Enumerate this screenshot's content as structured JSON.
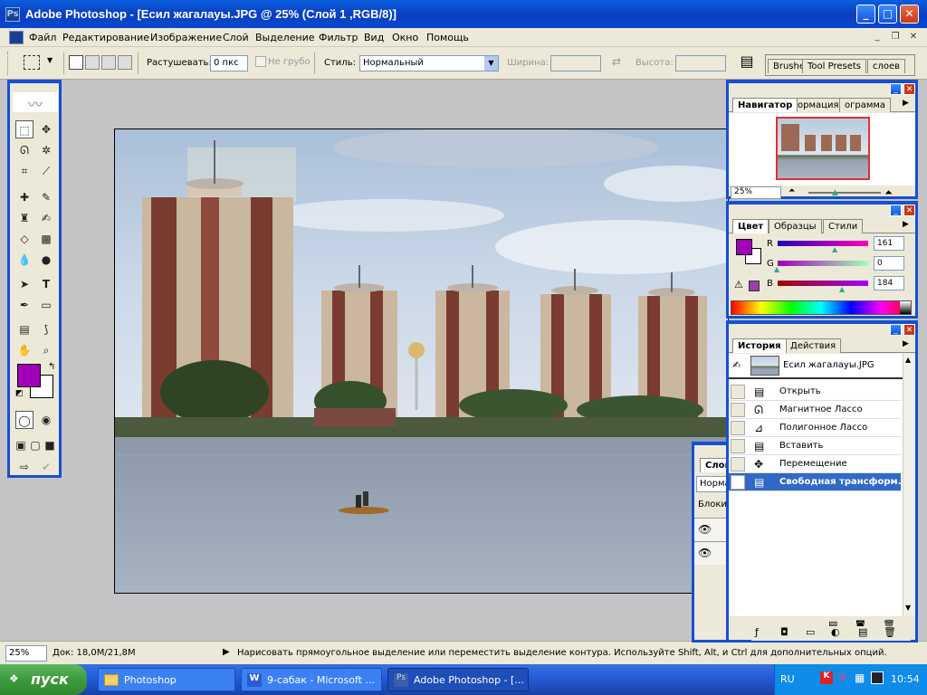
{
  "window": {
    "title": "Adobe Photoshop - [Есил жагалауы.JPG @ 25% (Слой 1 ,RGB/8)]",
    "min": "_",
    "max": "□",
    "close": "✕"
  },
  "menu": [
    "Файл",
    "Редактирование",
    "Изображение",
    "Слой",
    "Выделение",
    "Фильтр",
    "Вид",
    "Окно",
    "Помощь"
  ],
  "options": {
    "feather_label": "Растушевать:",
    "feather_value": "0 пкс",
    "antialias_label": "Не грубо",
    "style_label": "Стиль:",
    "style_value": "Нормальный",
    "width_label": "Ширина:",
    "height_label": "Высота:",
    "well_tabs": [
      "Brushe",
      "Tool Presets",
      "слоев"
    ]
  },
  "colors": {
    "foreground": "#a100b8",
    "background": "#ffffff",
    "accent": "#1550d0",
    "selection": "#3169c6"
  },
  "navigator": {
    "tabs": [
      "Навигатор",
      "ормация",
      "ограмма"
    ],
    "zoom": "25%"
  },
  "color_panel": {
    "tabs": [
      "Цвет",
      "Образцы",
      "Стили"
    ],
    "r_label": "R",
    "g_label": "G",
    "b_label": "B",
    "r": "161",
    "g": "0",
    "b": "184"
  },
  "history": {
    "tabs": [
      "История",
      "Действия"
    ],
    "snapshot": "Есил жагалауы.JPG",
    "items": [
      "Открыть",
      "Магнитное Лассо",
      "Полигонное Лассо",
      "Вставить",
      "Перемещение",
      "Свободная трансформ..."
    ]
  },
  "layers_peek": {
    "tab": "Слои",
    "blend": "Норма",
    "lock": "Блоки"
  },
  "status": {
    "zoom": "25%",
    "doc": "Док: 18,0M/21,8M",
    "hint": "Нарисовать прямоугольное выделение или переместить выделение контура.  Используйте Shift, Alt, и Ctrl для дополнительных опций."
  },
  "taskbar": {
    "start": "пуск",
    "tasks": [
      "Photoshop",
      "9-сабак - Microsoft ...",
      "Adobe Photoshop - [..."
    ],
    "lang": "RU",
    "clock": "10:54"
  }
}
